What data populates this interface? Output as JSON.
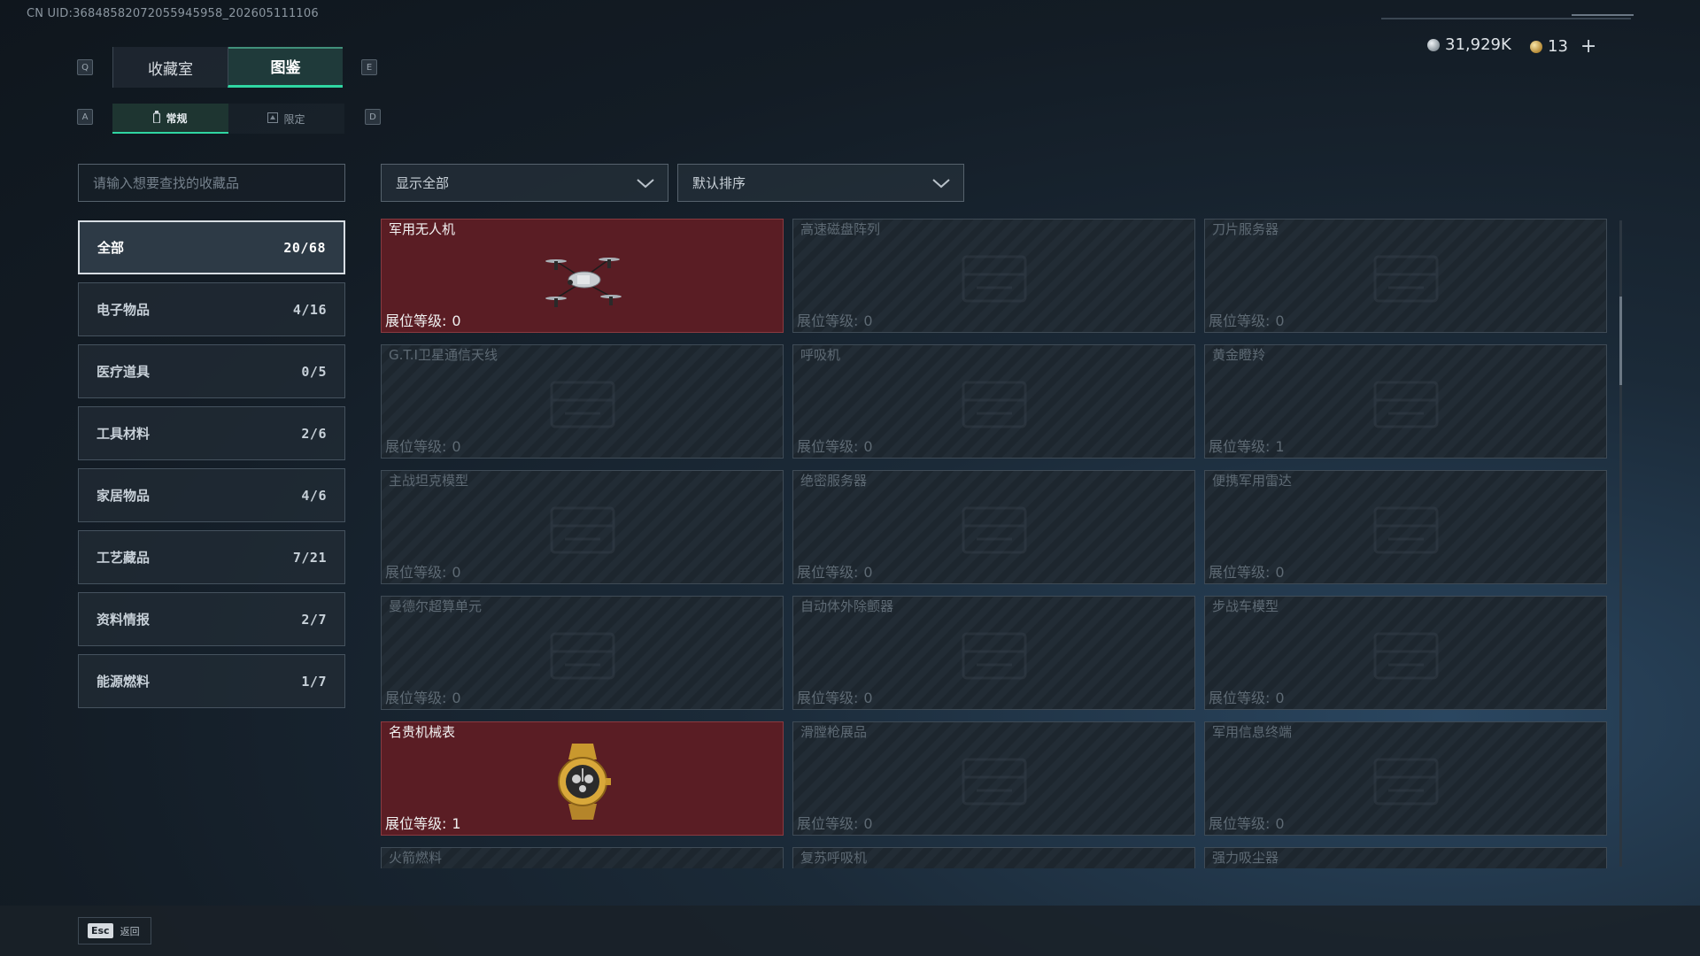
{
  "header": {
    "uid": "CN UID:36848582072055945958_202605111106"
  },
  "keys": {
    "q": "Q",
    "e": "E",
    "a": "A",
    "d": "D"
  },
  "tabs": {
    "collection": "收藏室",
    "catalog": "图鉴"
  },
  "subtabs": {
    "normal": "常规",
    "limited": "限定"
  },
  "currency": {
    "silver": "31,929K",
    "gold": "13",
    "plus": "+"
  },
  "search": {
    "placeholder": "请输入想要查找的收藏品"
  },
  "filter": {
    "show": "显示全部",
    "sort": "默认排序"
  },
  "categories": [
    {
      "label": "全部",
      "count": "20/68"
    },
    {
      "label": "电子物品",
      "count": "4/16"
    },
    {
      "label": "医疗道具",
      "count": "0/5"
    },
    {
      "label": "工具材料",
      "count": "2/6"
    },
    {
      "label": "家居物品",
      "count": "4/6"
    },
    {
      "label": "工艺藏品",
      "count": "7/21"
    },
    {
      "label": "资料情报",
      "count": "2/7"
    },
    {
      "label": "能源燃料",
      "count": "1/7"
    }
  ],
  "level_label": "展位等级:",
  "items": [
    {
      "name": "军用无人机",
      "level": "0",
      "owned": true,
      "icon": "drone-icon"
    },
    {
      "name": "高速磁盘阵列",
      "level": "0",
      "owned": false,
      "icon": "disk-array-icon"
    },
    {
      "name": "刀片服务器",
      "level": "0",
      "owned": false,
      "icon": "blade-server-icon"
    },
    {
      "name": "G.T.I卫星通信天线",
      "level": "0",
      "owned": false,
      "icon": "satellite-dish-icon"
    },
    {
      "name": "呼吸机",
      "level": "0",
      "owned": false,
      "icon": "ventilator-icon"
    },
    {
      "name": "黄金瞪羚",
      "level": "1",
      "owned": false,
      "icon": "gold-gazelle-icon"
    },
    {
      "name": "主战坦克模型",
      "level": "0",
      "owned": false,
      "icon": "tank-model-icon"
    },
    {
      "name": "绝密服务器",
      "level": "0",
      "owned": false,
      "icon": "secret-server-icon"
    },
    {
      "name": "便携军用雷达",
      "level": "0",
      "owned": false,
      "icon": "radar-icon"
    },
    {
      "name": "曼德尔超算单元",
      "level": "0",
      "owned": false,
      "icon": "supercomputer-icon"
    },
    {
      "name": "自动体外除颤器",
      "level": "0",
      "owned": false,
      "icon": "defibrillator-icon"
    },
    {
      "name": "步战车模型",
      "level": "0",
      "owned": false,
      "icon": "ifv-model-icon"
    },
    {
      "name": "名贵机械表",
      "level": "1",
      "owned": true,
      "icon": "watch-icon"
    },
    {
      "name": "滑膛枪展品",
      "level": "0",
      "owned": false,
      "icon": "musket-icon"
    },
    {
      "name": "军用信息终端",
      "level": "0",
      "owned": false,
      "icon": "terminal-icon"
    }
  ],
  "partial_items": [
    {
      "name": "火箭燃料"
    },
    {
      "name": "复苏呼吸机"
    },
    {
      "name": "强力吸尘器"
    }
  ],
  "footer": {
    "esc_key": "Esc",
    "back": "返回"
  },
  "colors": {
    "accent": "#2fd6a2",
    "owned_bg": "#5a1d24"
  }
}
